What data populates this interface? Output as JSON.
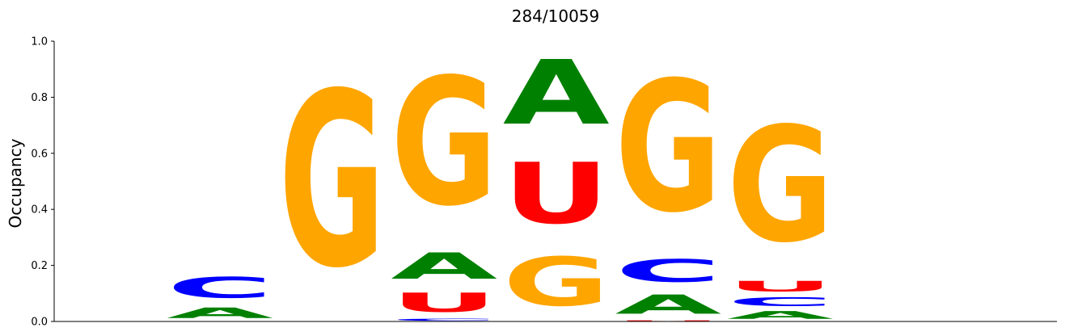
{
  "chart_data": {
    "type": "sequence-logo",
    "title": "284/10059",
    "ylabel": "Occupancy",
    "ylim": [
      0,
      1
    ],
    "yticks": [
      "0.0",
      "0.2",
      "0.4",
      "0.6",
      "0.8",
      "1.0"
    ],
    "grid": false,
    "colors": {
      "A": "#008000",
      "C": "#0000ff",
      "G": "#ffa500",
      "U": "#ff0000"
    },
    "positions": [
      {
        "position": 1,
        "stack": [
          {
            "letter": "A",
            "value": 0.06
          },
          {
            "letter": "C",
            "value": 0.12
          }
        ]
      },
      {
        "position": 2,
        "stack": [
          {
            "letter": "G",
            "value": 1.0
          }
        ]
      },
      {
        "position": 3,
        "stack": [
          {
            "letter": "C",
            "value": 0.012
          },
          {
            "letter": "U",
            "value": 0.11
          },
          {
            "letter": "A",
            "value": 0.15
          },
          {
            "letter": "G",
            "value": 0.73
          }
        ]
      },
      {
        "position": 4,
        "stack": [
          {
            "letter": "G",
            "value": 0.28
          },
          {
            "letter": "U",
            "value": 0.35
          },
          {
            "letter": "A",
            "value": 0.37
          }
        ]
      },
      {
        "position": 5,
        "stack": [
          {
            "letter": "U",
            "value": 0.005
          },
          {
            "letter": "A",
            "value": 0.11
          },
          {
            "letter": "C",
            "value": 0.13
          },
          {
            "letter": "G",
            "value": 0.75
          }
        ]
      },
      {
        "position": 6,
        "stack": [
          {
            "letter": "A",
            "value": 0.045
          },
          {
            "letter": "C",
            "value": 0.05
          },
          {
            "letter": "U",
            "value": 0.06
          },
          {
            "letter": "G",
            "value": 0.66
          }
        ]
      }
    ]
  }
}
